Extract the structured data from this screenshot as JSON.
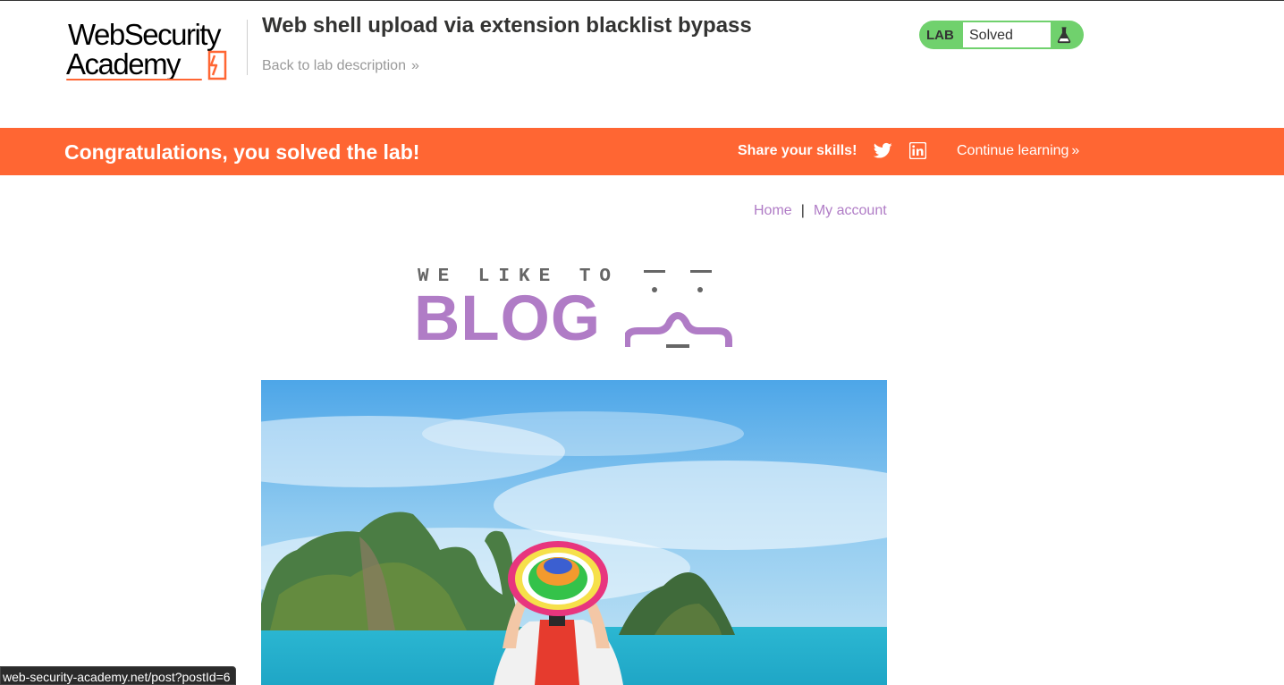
{
  "header": {
    "logo_line1": "WebSecurity",
    "logo_line2": "Academy",
    "lab_title": "Web shell upload via extension blacklist bypass",
    "back_link": "Back to lab description",
    "lab_badge": "LAB",
    "lab_status": "Solved"
  },
  "banner": {
    "message": "Congratulations, you solved the lab!",
    "share_label": "Share your skills!",
    "continue_link": "Continue learning"
  },
  "nav": {
    "home": "Home",
    "separator": "|",
    "my_account": "My account"
  },
  "blog_logo": {
    "tagline": "WE LIKE TO",
    "word": "BLOG"
  },
  "status_bar": {
    "url": "web-security-academy.net/post?postId=6"
  },
  "colors": {
    "accent_orange": "#ff6633",
    "lab_green": "#70d16d",
    "link_purple": "#b07cc6"
  },
  "icons": {
    "twitter": "twitter-icon",
    "linkedin": "linkedin-icon",
    "flask": "flask-icon",
    "chevron": "double-chevron-right-icon"
  }
}
